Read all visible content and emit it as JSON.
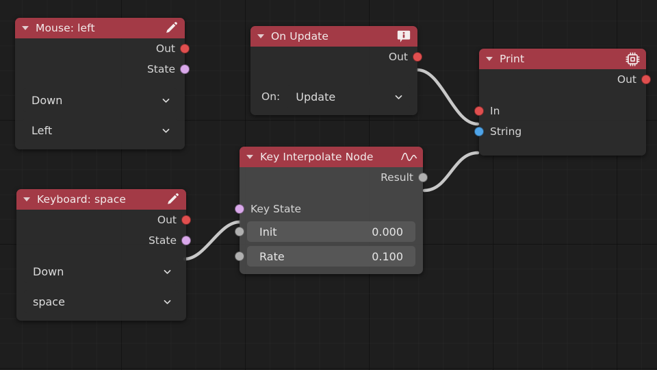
{
  "app": {
    "editor": "node-editor",
    "background_color": "#1e1e1e",
    "grid_color": "#000000",
    "link_color": "#c8c8c8",
    "header_color": "#a33a46",
    "node_body_color": "#2c2c2c",
    "node_body_light_color": "#484848"
  },
  "socket_colors": {
    "execution": "#e04f4f",
    "state": "#d9a8ea",
    "float": "#b0b0b0",
    "string": "#4fa4e8"
  },
  "nodes": [
    {
      "id": "mouse-left",
      "title": "Mouse: left",
      "header_icon": "pencil-icon",
      "outputs": [
        {
          "label": "Out",
          "color": "execution"
        },
        {
          "label": "State",
          "color": "state"
        }
      ],
      "inputs": [],
      "widgets": [
        {
          "type": "dropdown",
          "value": "Down"
        },
        {
          "type": "dropdown",
          "value": "Left"
        }
      ]
    },
    {
      "id": "keyboard-space",
      "title": "Keyboard: space",
      "header_icon": "pencil-icon",
      "outputs": [
        {
          "label": "Out",
          "color": "execution"
        },
        {
          "label": "State",
          "color": "state"
        }
      ],
      "inputs": [],
      "widgets": [
        {
          "type": "dropdown",
          "value": "Down"
        },
        {
          "type": "dropdown",
          "value": "space"
        }
      ]
    },
    {
      "id": "on-update",
      "title": "On Update",
      "header_icon": "info-bubble-icon",
      "outputs": [
        {
          "label": "Out",
          "color": "execution"
        }
      ],
      "inputs": [],
      "widgets": [
        {
          "type": "labelled-dropdown",
          "label": "On:",
          "value": "Update"
        }
      ]
    },
    {
      "id": "key-interpolate",
      "title": "Key Interpolate Node",
      "header_icon": "wave-curve-icon",
      "outputs": [
        {
          "label": "Result",
          "color": "float"
        }
      ],
      "inputs": [
        {
          "label": "Key State",
          "color": "state"
        }
      ],
      "fields": [
        {
          "label": "Init",
          "value": "0.000",
          "color": "float"
        },
        {
          "label": "Rate",
          "value": "0.100",
          "color": "float"
        }
      ]
    },
    {
      "id": "print",
      "title": "Print",
      "header_icon": "cpu-chip-icon",
      "outputs": [
        {
          "label": "Out",
          "color": "execution"
        }
      ],
      "inputs": [
        {
          "label": "In",
          "color": "execution"
        },
        {
          "label": "String",
          "color": "string"
        }
      ]
    }
  ],
  "links": [
    {
      "from": "on-update.Out",
      "to": "print.In"
    },
    {
      "from": "key-interpolate.Result",
      "to": "print.String"
    },
    {
      "from": "keyboard-space.State",
      "to": "key-interpolate.KeyState"
    }
  ]
}
